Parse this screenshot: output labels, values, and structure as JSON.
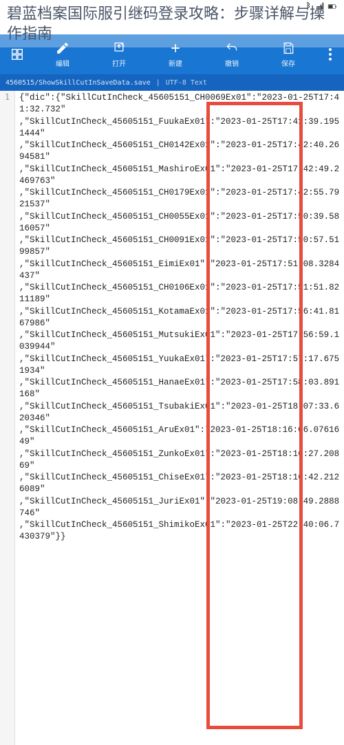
{
  "page_title": "碧蓝档案国际服引继码登录攻略：步骤详解与操作指南",
  "status": {
    "battery": "",
    "signal": ""
  },
  "toolbar": {
    "items": [
      {
        "label": "编辑"
      },
      {
        "label": "打开"
      },
      {
        "label": "新建"
      },
      {
        "label": "撤销"
      },
      {
        "label": "保存"
      }
    ]
  },
  "file_tab": {
    "name": "4560515/ShowSkillCutInSaveData.save",
    "encoding": "UTF-8  Text",
    "divider": "|"
  },
  "gutter": {
    "line_num": "1"
  },
  "code": "{\"dic\":{\"SkillCutInCheck_45605151_CH0069Ex01\":\"2023-01-25T17:41:32.732\"\n,\"SkillCutInCheck_45605151_FuukaEx01\":\"2023-01-25T17:41:39.1951444\"\n,\"SkillCutInCheck_45605151_CH0142Ex01\":\"2023-01-25T17:42:40.2694581\"\n,\"SkillCutInCheck_45605151_MashiroEx01\":\"2023-01-25T17:42:49.2469763\"\n,\"SkillCutInCheck_45605151_CH0179Ex01\":\"2023-01-25T17:42:55.7921537\"\n,\"SkillCutInCheck_45605151_CH0055Ex01\":\"2023-01-25T17:50:39.5816057\"\n,\"SkillCutInCheck_45605151_CH0091Ex01\":\"2023-01-25T17:50:57.5199857\"\n,\"SkillCutInCheck_45605151_EimiEx01\":\"2023-01-25T17:51:08.3284437\"\n,\"SkillCutInCheck_45605151_CH0106Ex01\":\"2023-01-25T17:51:51.8211189\"\n,\"SkillCutInCheck_45605151_KotamaEx01\":\"2023-01-25T17:56:41.8167986\"\n,\"SkillCutInCheck_45605151_MutsukiEx01\":\"2023-01-25T17:56:59.1039944\"\n,\"SkillCutInCheck_45605151_YuukaEx01\":\"2023-01-25T17:57:17.6751934\"\n,\"SkillCutInCheck_45605151_HanaeEx01\":\"2023-01-25T17:58:03.891168\"\n,\"SkillCutInCheck_45605151_TsubakiEx01\":\"2023-01-25T18:07:33.620346\"\n,\"SkillCutInCheck_45605151_AruEx01\":\"2023-01-25T18:16:06.0761649\"\n,\"SkillCutInCheck_45605151_ZunkoEx01\":\"2023-01-25T18:16:27.20869\"\n,\"SkillCutInCheck_45605151_ChiseEx01\":\"2023-01-25T18:16:42.2126089\"\n,\"SkillCutInCheck_45605151_JuriEx01\":\"2023-01-25T19:08:49.2888746\"\n,\"SkillCutInCheck_45605151_ShimikoEx01\":\"2023-01-25T22:40:06.7430379\"}}"
}
